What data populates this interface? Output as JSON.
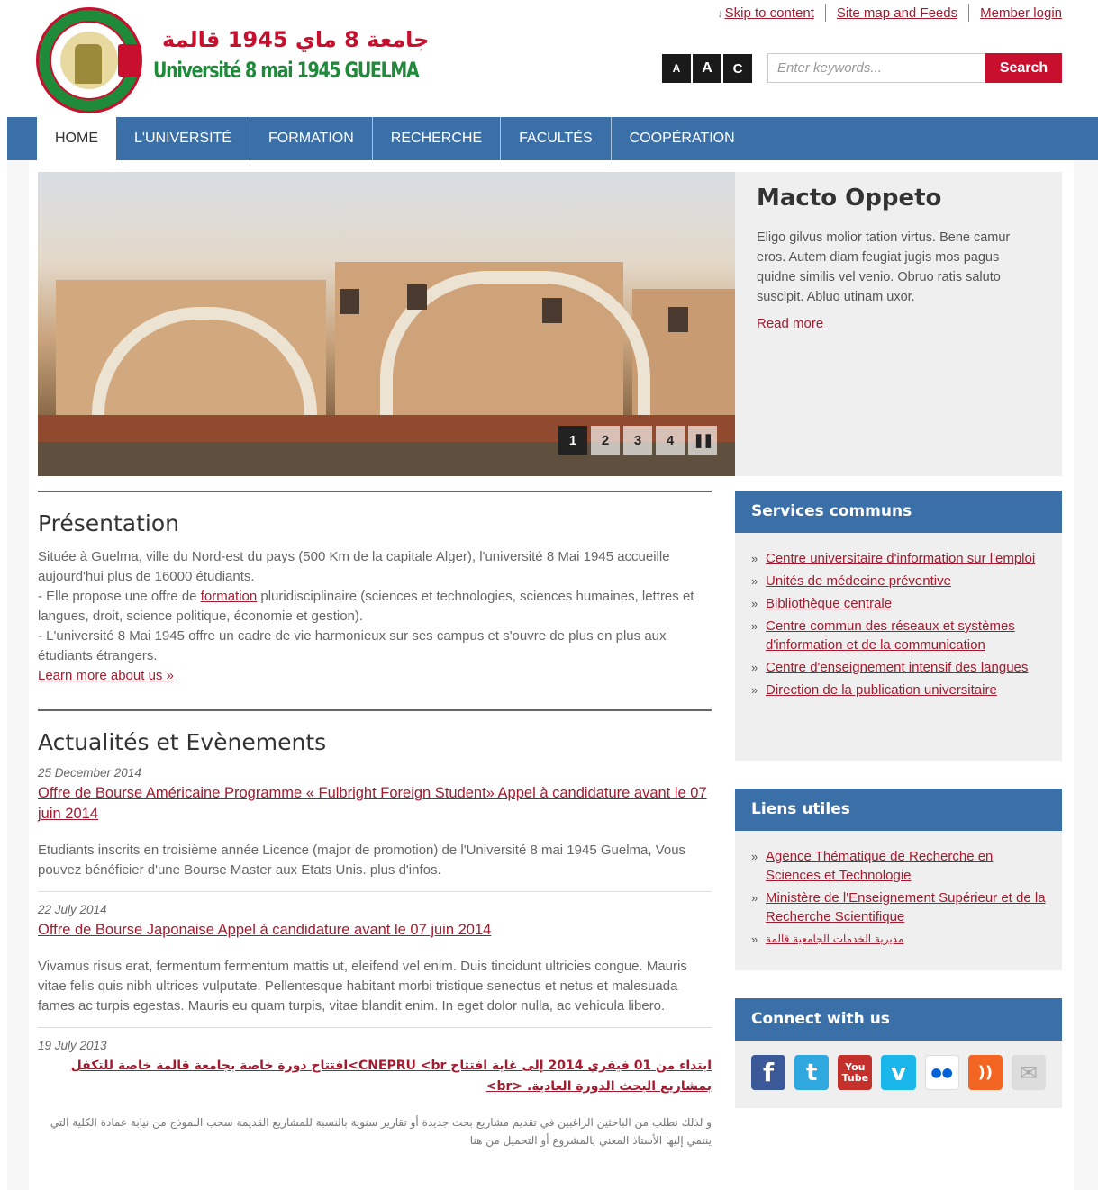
{
  "header": {
    "logo_arabic": "جامعة 8 ماي 1945 قالمة",
    "logo_french": "Université 8 mai 1945 GUELMA",
    "links": [
      {
        "label": "Skip to content"
      },
      {
        "label": "Site map and Feeds"
      },
      {
        "label": "Member login"
      }
    ],
    "font_sizes": [
      "A",
      "A",
      "C"
    ],
    "search": {
      "placeholder": "Enter keywords...",
      "button": "Search"
    }
  },
  "nav": {
    "items": [
      {
        "label": "HOME"
      },
      {
        "label": "L'UNIVERSITÉ"
      },
      {
        "label": "FORMATION"
      },
      {
        "label": "RECHERCHE"
      },
      {
        "label": "FACULTÉS"
      },
      {
        "label": "COOPÉRATION"
      }
    ]
  },
  "slider": {
    "pages": [
      "1",
      "2",
      "3",
      "4"
    ],
    "pause": "❚❚",
    "title": "Macto Oppeto",
    "text": "Eligo gilvus molior tation virtus. Bene camur eros. Autem diam feugiat jugis mos pagus quidne similis vel venio. Obruo ratis saluto suscipit. Abluo utinam uxor.",
    "read_more": "Read more"
  },
  "presentation": {
    "heading": "Présentation",
    "p1": "Située à Guelma, ville du Nord-est du pays (500 Km de la capitale Alger), l'université 8 Mai 1945 accueille aujourd'hui plus de  16000 étudiants.",
    "p2_before": "- Elle propose une offre de ",
    "p2_link": "formation",
    "p2_after": " pluridisciplinaire (sciences et technologies, sciences humaines, lettres et langues, droit, science politique, économie et gestion).",
    "p3": "- L'université 8 Mai 1945 offre un cadre de vie harmonieux sur ses campus et s'ouvre de plus en plus aux étudiants étrangers.",
    "learn_more": "Learn more about us »"
  },
  "news": {
    "heading": "Actualités et Evènements",
    "items": [
      {
        "date": "25 December 2014",
        "title": "Offre de Bourse Américaine Programme « Fulbright Foreign Student» Appel à candidature avant le 07 juin 2014",
        "body": "Etudiants inscrits en troisième année Licence (major de promotion) de l'Université 8 mai 1945 Guelma, Vous pouvez bénéficier d'une Bourse Master aux Etats Unis. plus d'infos."
      },
      {
        "date": "22 July 2014",
        "title": "Offre de Bourse Japonaise Appel à candidature avant le 07 juin 2014",
        "body": "Vivamus risus erat, fermentum fermentum mattis ut, eleifend vel enim. Duis tincidunt ultricies congue. Mauris vitae felis quis nibh ultrices vulputate. Pellentesque habitant morbi tristique senectus et netus et malesuada fames ac turpis egestas. Mauris eu quam turpis, vitae blandit enim. In eget dolor nulla, ac vehicula libero."
      },
      {
        "date": "19 July 2013",
        "title": "ابتداء من 01 فيفري 2014 إلى غاية افتتاح CNEPRU <br>افتتاح دورة خاصة بجامعة قالمة خاصة للتكفل بمشاريع البحث الدورة العادية. <br>",
        "body": "و لذلك نطلب من الباحثين الراغبين في تقديم مشاريع بحث جديدة أو تقارير سنوية بالنسبة للمشاريع القديمة سحب النموذج من نيابة عمادة الكلية التي ينتمي إليها الأستاذ المعني بالمشروع أو التحميل من هنا"
      }
    ]
  },
  "sidebar": {
    "services": {
      "title": "Services communs",
      "items": [
        "Centre universitaire d'information sur l'emploi",
        "Unités de médecine préventive",
        "Bibliothèque centrale",
        "Centre commun des réseaux et systèmes d'information et de la communication",
        "Centre d'enseignement intensif des langues",
        "Direction de la publication universitaire"
      ]
    },
    "links": {
      "title": "Liens utiles",
      "items": [
        "Agence Thématique de Recherche en Sciences et Technologie",
        "Ministère de l'Enseignement Supérieur et de la Recherche Scientifique",
        "مديرية الخدمات الجامعية قالمة"
      ]
    },
    "connect": {
      "title": "Connect with us",
      "icons": [
        {
          "name": "facebook-icon",
          "glyph": "f",
          "color": "#3b5998"
        },
        {
          "name": "twitter-icon",
          "glyph": "t",
          "color": "#2fa8e0"
        },
        {
          "name": "youtube-icon",
          "glyph": "You Tube",
          "color": "#c4302b"
        },
        {
          "name": "vimeo-icon",
          "glyph": "v",
          "color": "#1ab7ea"
        },
        {
          "name": "flickr-icon",
          "glyph": "●●",
          "color": "#ffffff"
        },
        {
          "name": "rss-icon",
          "glyph": "))",
          "color": "#f26522"
        },
        {
          "name": "email-icon",
          "glyph": "✉",
          "color": "#dddddd"
        }
      ]
    }
  },
  "colors": {
    "nav": "#3b6fa8",
    "accent": "#c8102e",
    "link": "#a31b2e"
  }
}
